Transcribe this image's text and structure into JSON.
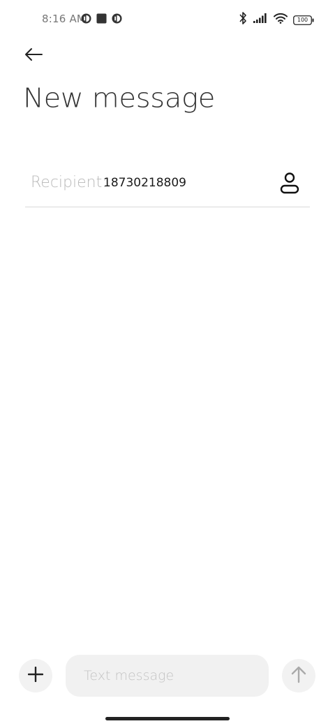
{
  "status_bar": {
    "time": "8:16 AM",
    "battery": "100",
    "icons": [
      "app-notification-icon",
      "square-notification-icon",
      "app-notification-icon",
      "bluetooth-icon",
      "signal-icon",
      "wifi-icon",
      "battery-icon"
    ]
  },
  "header": {
    "back_icon": "arrow-left-icon",
    "title": "New message"
  },
  "recipient": {
    "label": "Recipient:",
    "value": "18730218809",
    "contact_icon": "person-icon"
  },
  "composer": {
    "attach_icon": "plus-icon",
    "placeholder": "Text message",
    "value": "",
    "send_icon": "arrow-up-icon"
  },
  "colors": {
    "background": "#ffffff",
    "input_background": "#f1f1f1",
    "divider": "#d9d9d9",
    "muted_text": "#b9b9b9"
  }
}
